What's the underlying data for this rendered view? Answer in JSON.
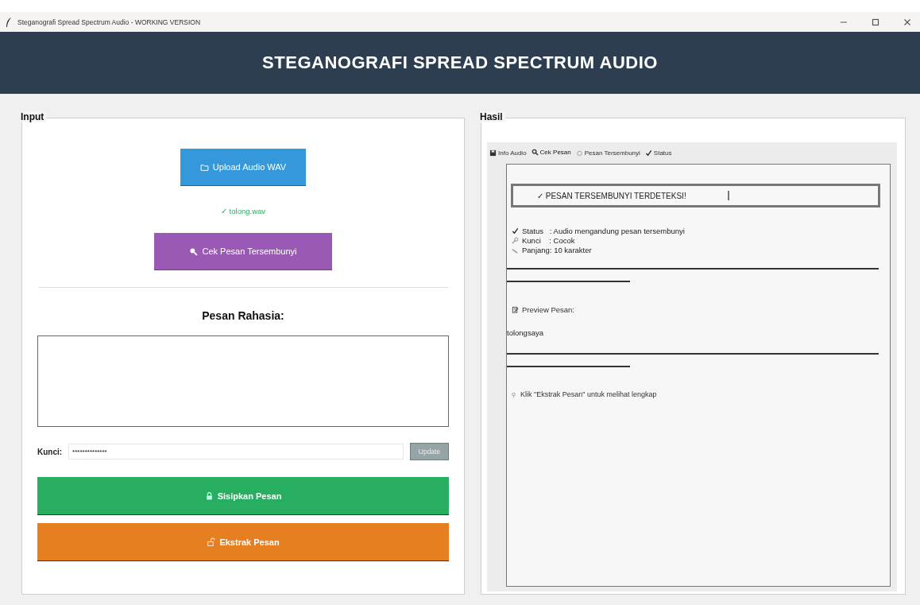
{
  "window": {
    "title": "Steganografi Spread Spectrum Audio - WORKING VERSION"
  },
  "header": {
    "title": "STEGANOGRAFI SPREAD SPECTRUM AUDIO"
  },
  "input_panel": {
    "title": "Input",
    "upload_button": {
      "label": "Upload Audio WAV"
    },
    "file_status": "✓ tolong.wav",
    "check_button": {
      "label": "Cek Pesan Tersembunyi"
    },
    "message_label": "Pesan Rahasia:",
    "key_label": "Kunci:",
    "key_field": {
      "value": "**************"
    },
    "update_button": {
      "label": "Update"
    },
    "embed_button": {
      "label": "Sisipkan Pesan"
    },
    "extract_button": {
      "label": "Ekstrak Pesan"
    }
  },
  "result_panel": {
    "title": "Hasil",
    "tabs": [
      {
        "label": "Info Audio",
        "kind": "disk",
        "selected": false
      },
      {
        "label": "Cek Pesan",
        "kind": "magnifier",
        "selected": true
      },
      {
        "label": "Pesan Tersembunyi",
        "kind": "circle",
        "selected": false
      },
      {
        "label": "Status",
        "kind": "check",
        "selected": false
      }
    ],
    "banner": "✓ PESAN TERSEMBUNYI TERDETEKSI!",
    "details": [
      {
        "kind": "check",
        "text": "Status   : Audio mengandung pesan tersembunyi"
      },
      {
        "kind": "key",
        "text": "Kunci    : Cocok"
      },
      {
        "kind": "ruler",
        "text": "Panjang: 10 karakter"
      }
    ],
    "preview_label": "Preview Pesan:",
    "preview_text": "tolongsaya",
    "hint": "Klik \"Ekstrak Pesan\" untuk melihat lengkap"
  }
}
